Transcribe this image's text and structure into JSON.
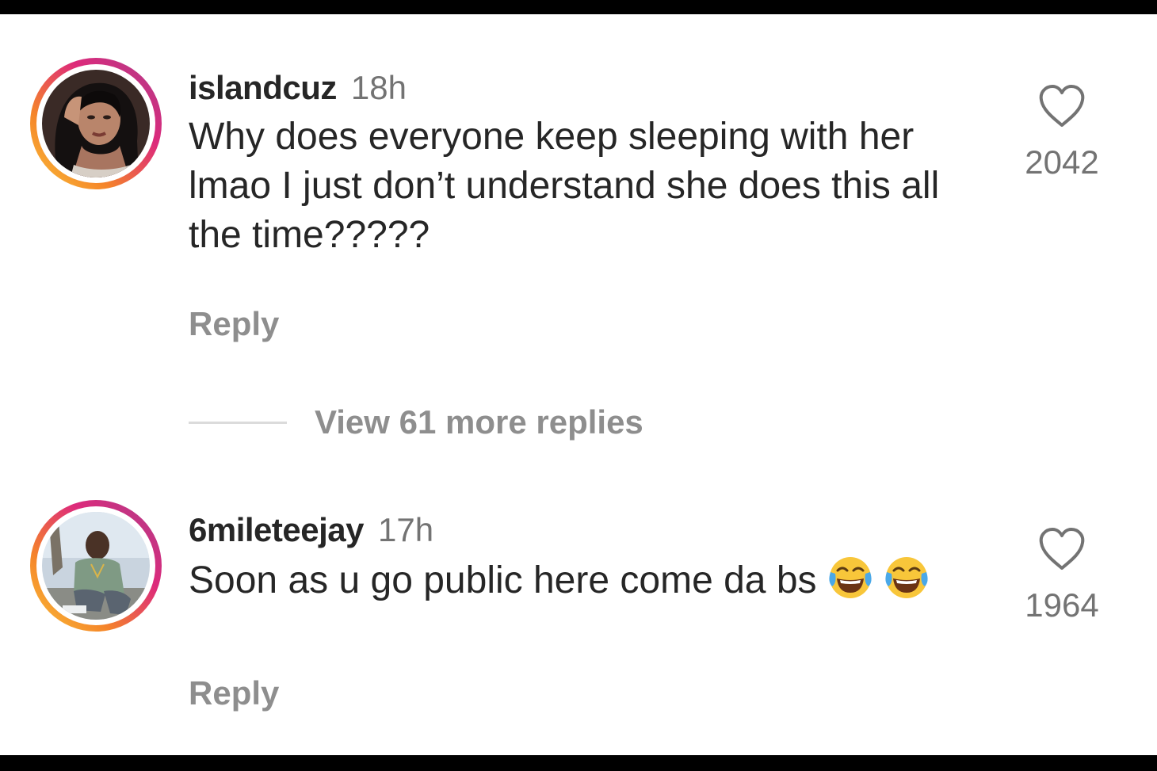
{
  "comments": [
    {
      "username": "islandcuz",
      "time": "18h",
      "text": "Why does everyone keep sleeping with her lmao I just don’t understand she does this all the time?????",
      "reply_label": "Reply",
      "likes": "2042",
      "avatar": "woman-with-long-black-hair-photo",
      "heart_icon": "heart-outline-icon"
    },
    {
      "username": "6mileteejay",
      "time": "17h",
      "text": "Soon as u go public here come da bs",
      "emoji": [
        "face-with-tears-of-joy",
        "face-with-tears-of-joy"
      ],
      "reply_label": "Reply",
      "likes": "1964",
      "avatar": "man-crouching-outdoors-photo",
      "heart_icon": "heart-outline-icon"
    }
  ],
  "view_more_replies": "View 61 more replies",
  "colors": {
    "text_primary": "#262626",
    "text_secondary": "#737373",
    "reply_gray": "#8e8e8e",
    "divider": "#dbdbdb",
    "story_ring_start": "#f9c33a",
    "story_ring_end": "#c13584"
  }
}
